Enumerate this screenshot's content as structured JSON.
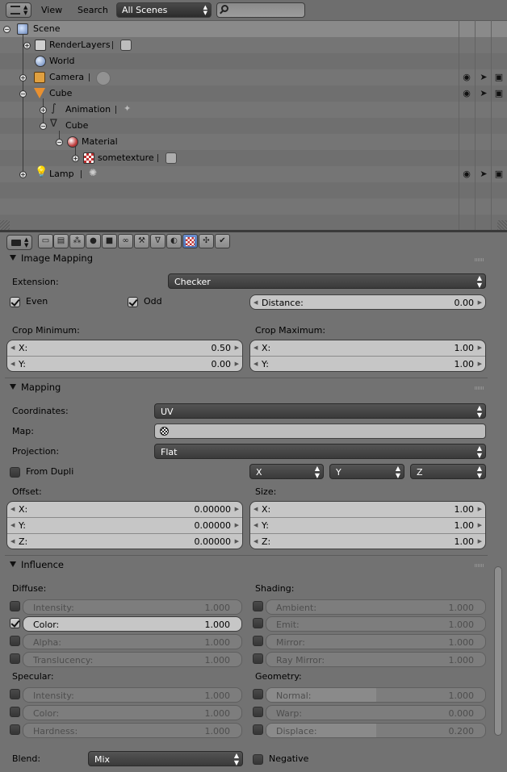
{
  "outliner": {
    "menu": {
      "view": "View",
      "search": "Search"
    },
    "scene_select": "All Scenes",
    "rows": [
      {
        "label": "Scene"
      },
      {
        "label": "RenderLayers"
      },
      {
        "label": "World"
      },
      {
        "label": "Camera"
      },
      {
        "label": "Cube"
      },
      {
        "label": "Animation"
      },
      {
        "label": "Cube"
      },
      {
        "label": "Material"
      },
      {
        "label": "sometexture"
      },
      {
        "label": "Lamp"
      }
    ]
  },
  "image_mapping": {
    "title": "Image Mapping",
    "extension_label": "Extension:",
    "extension_value": "Checker",
    "even_label": "Even",
    "even_checked": true,
    "odd_label": "Odd",
    "odd_checked": true,
    "distance_label": "Distance:",
    "distance_value": "0.00",
    "crop_min_label": "Crop Minimum:",
    "crop_min_x_label": "X:",
    "crop_min_x": "0.50",
    "crop_min_y_label": "Y:",
    "crop_min_y": "0.00",
    "crop_max_label": "Crop Maximum:",
    "crop_max_x_label": "X:",
    "crop_max_x": "1.00",
    "crop_max_y_label": "Y:",
    "crop_max_y": "1.00"
  },
  "mapping": {
    "title": "Mapping",
    "coordinates_label": "Coordinates:",
    "coordinates_value": "UV",
    "map_label": "Map:",
    "projection_label": "Projection:",
    "projection_value": "Flat",
    "from_dupli_label": "From Dupli",
    "axis_x": "X",
    "axis_y": "Y",
    "axis_z": "Z",
    "offset_label": "Offset:",
    "offset": [
      {
        "l": "X:",
        "v": "0.00000"
      },
      {
        "l": "Y:",
        "v": "0.00000"
      },
      {
        "l": "Z:",
        "v": "0.00000"
      }
    ],
    "size_label": "Size:",
    "size": [
      {
        "l": "X:",
        "v": "1.00"
      },
      {
        "l": "Y:",
        "v": "1.00"
      },
      {
        "l": "Z:",
        "v": "1.00"
      }
    ]
  },
  "influence": {
    "title": "Influence",
    "diffuse_label": "Diffuse:",
    "diffuse": [
      {
        "l": "Intensity:",
        "v": "1.000",
        "on": false
      },
      {
        "l": "Color:",
        "v": "1.000",
        "on": true
      },
      {
        "l": "Alpha:",
        "v": "1.000",
        "on": false
      },
      {
        "l": "Translucency:",
        "v": "1.000",
        "on": false
      }
    ],
    "shading_label": "Shading:",
    "shading": [
      {
        "l": "Ambient:",
        "v": "1.000"
      },
      {
        "l": "Emit:",
        "v": "1.000"
      },
      {
        "l": "Mirror:",
        "v": "1.000"
      },
      {
        "l": "Ray Mirror:",
        "v": "1.000"
      }
    ],
    "specular_label": "Specular:",
    "specular": [
      {
        "l": "Intensity:",
        "v": "1.000"
      },
      {
        "l": "Color:",
        "v": "1.000"
      },
      {
        "l": "Hardness:",
        "v": "1.000"
      }
    ],
    "geometry_label": "Geometry:",
    "geometry": [
      {
        "l": "Normal:",
        "v": "1.000",
        "fill": 0.5
      },
      {
        "l": "Warp:",
        "v": "0.000",
        "fill": 0.0
      },
      {
        "l": "Displace:",
        "v": "0.200",
        "fill": 0.5
      }
    ],
    "blend_label": "Blend:",
    "blend_value": "Mix",
    "negative_label": "Negative"
  }
}
